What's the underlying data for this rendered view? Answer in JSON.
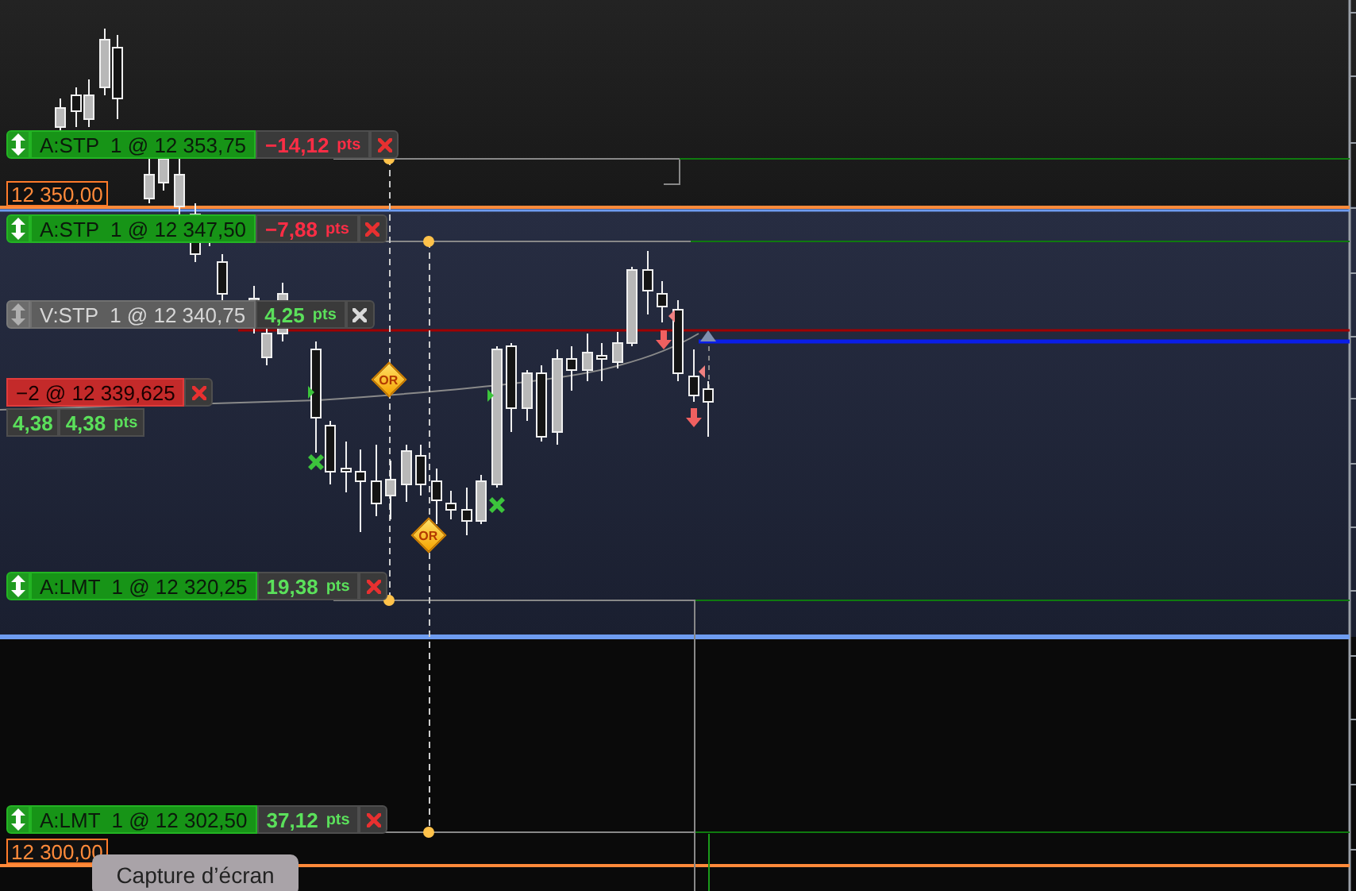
{
  "orders": [
    {
      "text": "A:STP  1 @ 12 353,75",
      "pnl": "−14,12",
      "unit": "pts",
      "loss": true,
      "disabled": false
    },
    {
      "text": "A:STP  1 @ 12 347,50",
      "pnl": "−7,88",
      "unit": "pts",
      "loss": true,
      "disabled": false
    },
    {
      "text": "V:STP  1 @ 12 340,75",
      "pnl": "4,25",
      "unit": "pts",
      "loss": false,
      "disabled": true
    },
    {
      "text": "A:LMT  1 @ 12 320,25",
      "pnl": "19,38",
      "unit": "pts",
      "loss": false,
      "disabled": false
    },
    {
      "text": "A:LMT  1 @ 12 302,50",
      "pnl": "37,12",
      "unit": "pts",
      "loss": false,
      "disabled": false
    }
  ],
  "position": {
    "label": "−2 @ 12 339,625",
    "points": "4,38",
    "pnl": "4,38",
    "unit": "pts",
    "loss": false
  },
  "price_tags": [
    {
      "text": "12 350,00"
    },
    {
      "text": "12 300,00"
    }
  ],
  "signals": [
    {
      "label": "OR"
    },
    {
      "label": "OR"
    }
  ],
  "tooltip": {
    "text": "Capture d’écran"
  }
}
